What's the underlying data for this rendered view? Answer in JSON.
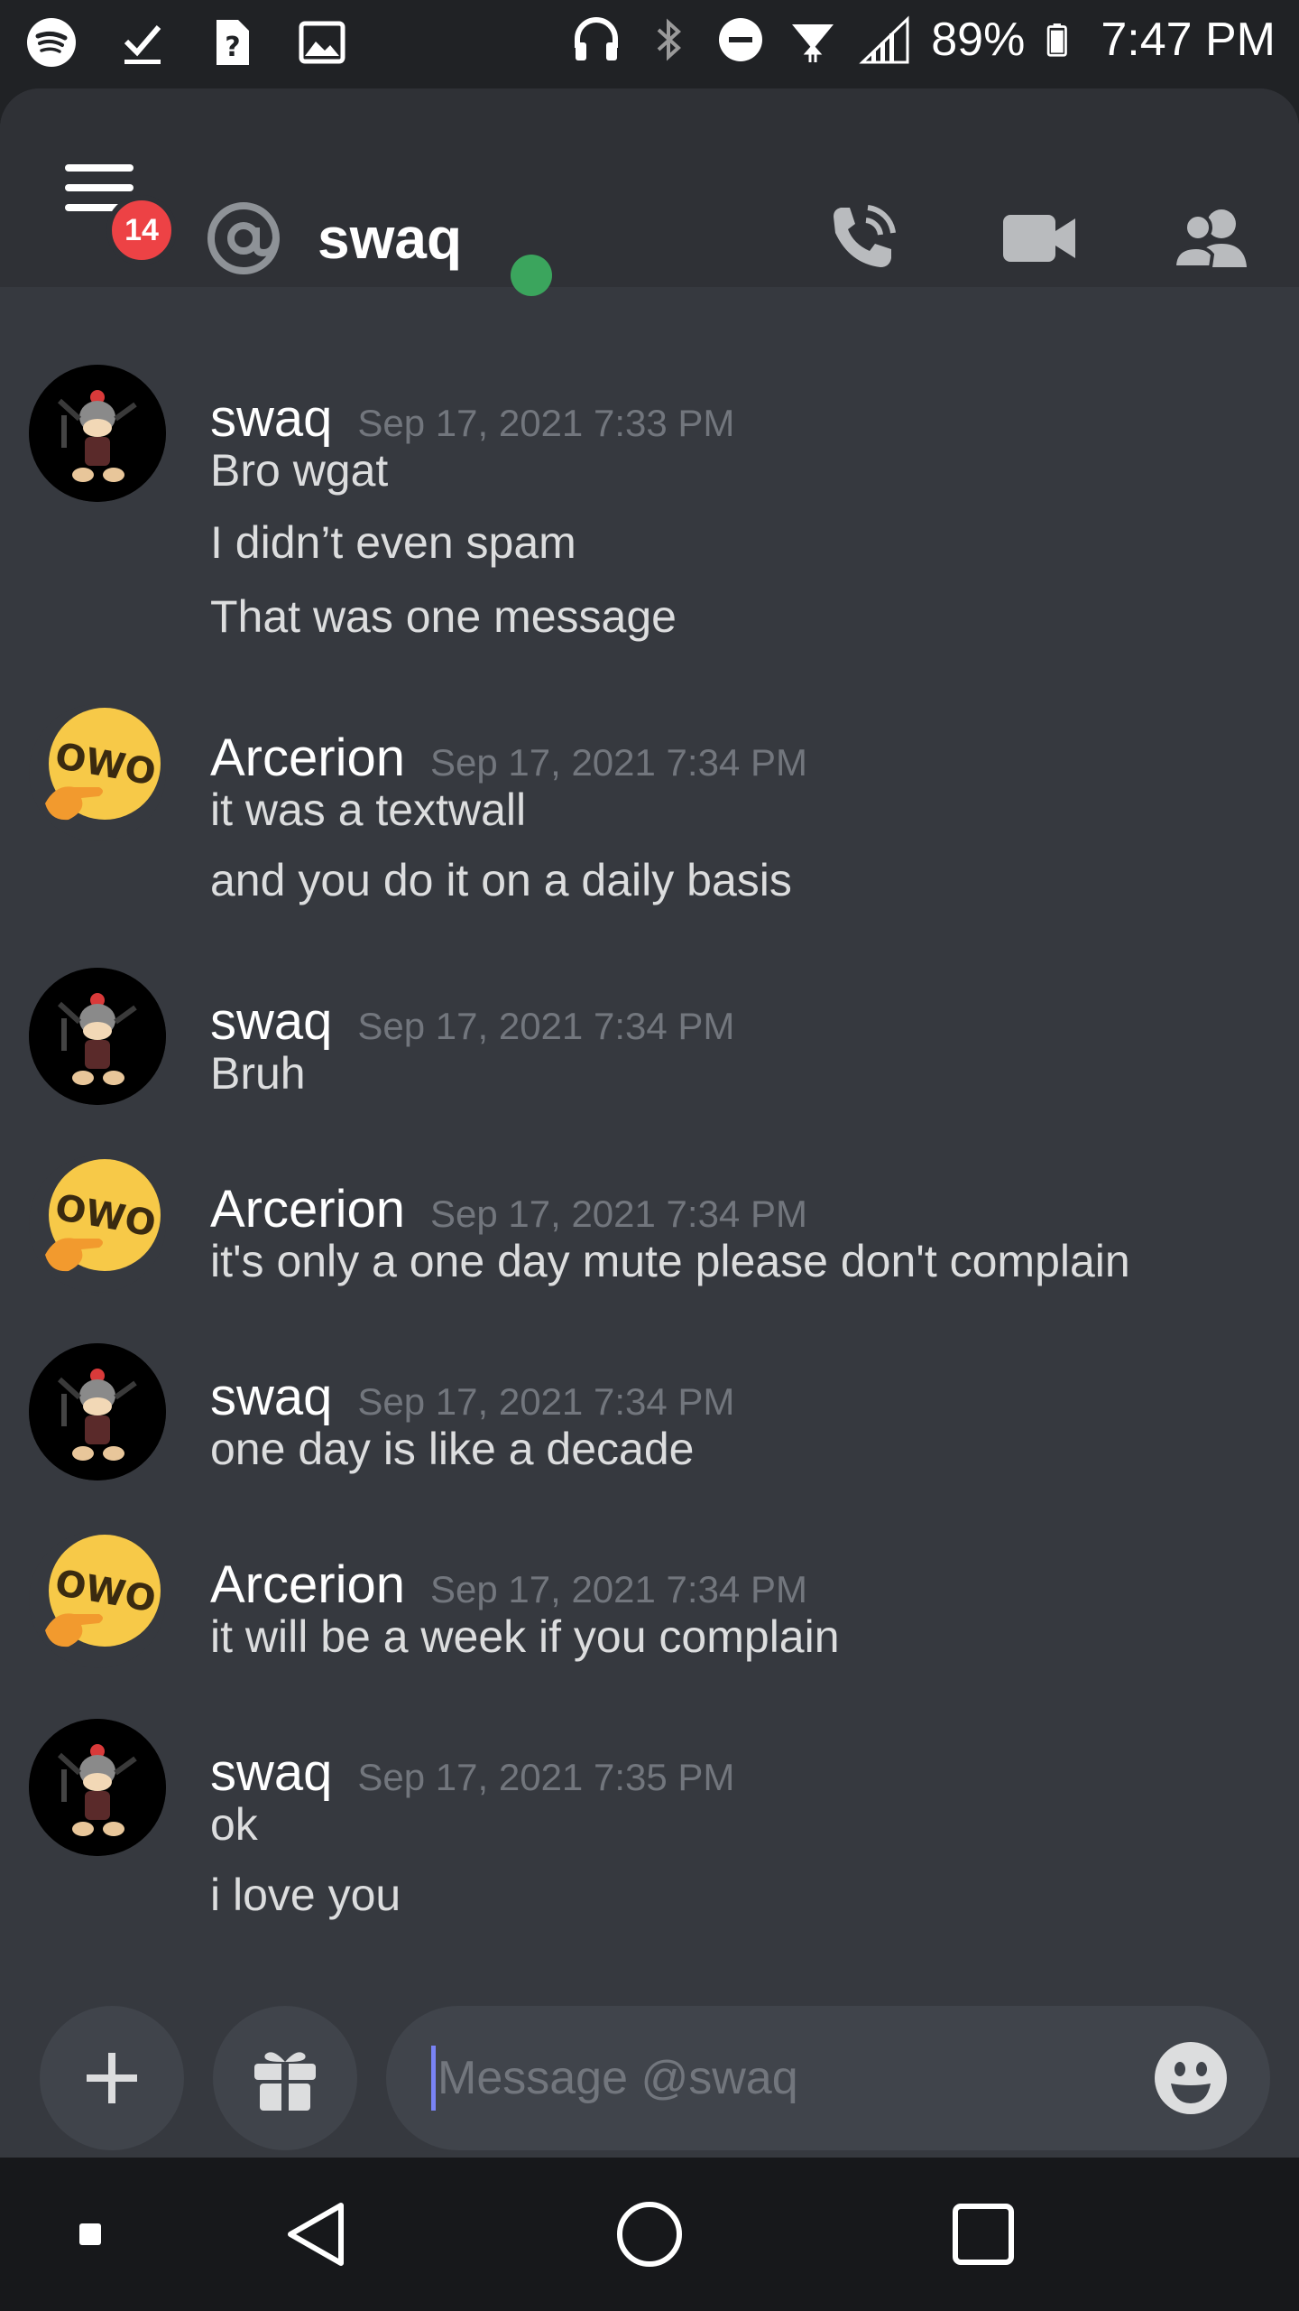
{
  "status_bar": {
    "battery_percent": "89%",
    "time": "7:47 PM",
    "left_icons": [
      "spotify-icon",
      "checkmark-icon",
      "unknown-file-icon",
      "image-icon"
    ],
    "right_icons": [
      "headphones-icon",
      "bluetooth-icon",
      "do-not-disturb-icon",
      "wifi-icon",
      "signal-icon",
      "battery-icon"
    ]
  },
  "header": {
    "notification_count": "14",
    "channel_name": "swaq",
    "status_color": "#3ba55d",
    "buttons": [
      "voice-call-icon",
      "video-call-icon",
      "members-icon"
    ]
  },
  "messages": [
    {
      "author": "swaq",
      "timestamp": "Sep 17, 2021 7:33 PM",
      "avatar": "swaq-avatar",
      "lines": [
        "Bro wgat",
        "I didn’t even spam",
        "That was one message"
      ]
    },
    {
      "author": "Arcerion",
      "timestamp": "Sep 17, 2021 7:34 PM",
      "avatar": "owo-avatar",
      "lines": [
        "it was a textwall",
        "and you do it on a daily basis"
      ]
    },
    {
      "author": "swaq",
      "timestamp": "Sep 17, 2021 7:34 PM",
      "avatar": "swaq-avatar",
      "lines": [
        "Bruh"
      ]
    },
    {
      "author": "Arcerion",
      "timestamp": "Sep 17, 2021 7:34 PM",
      "avatar": "owo-avatar",
      "lines": [
        "it's only a one day mute please don't complain"
      ]
    },
    {
      "author": "swaq",
      "timestamp": "Sep 17, 2021 7:34 PM",
      "avatar": "swaq-avatar",
      "lines": [
        "one day is like a decade"
      ]
    },
    {
      "author": "Arcerion",
      "timestamp": "Sep 17, 2021 7:34 PM",
      "avatar": "owo-avatar",
      "lines": [
        "it will be a week if you complain"
      ]
    },
    {
      "author": "swaq",
      "timestamp": "Sep 17, 2021 7:35 PM",
      "avatar": "swaq-avatar",
      "lines": [
        "ok",
        "i love you"
      ]
    }
  ],
  "avatar_text": {
    "owo": "OWO"
  },
  "composer": {
    "placeholder": "Message @swaq",
    "buttons": [
      "plus-icon",
      "gift-icon",
      "emoji-icon"
    ]
  },
  "nav_bar": {
    "buttons": [
      "small-square-icon",
      "back-icon",
      "home-icon",
      "recents-icon"
    ]
  },
  "colors": {
    "background": "#36393f",
    "header": "#2f3136",
    "badge": "#ed4245",
    "text": "#dcddde",
    "timestamp": "#72767d"
  }
}
